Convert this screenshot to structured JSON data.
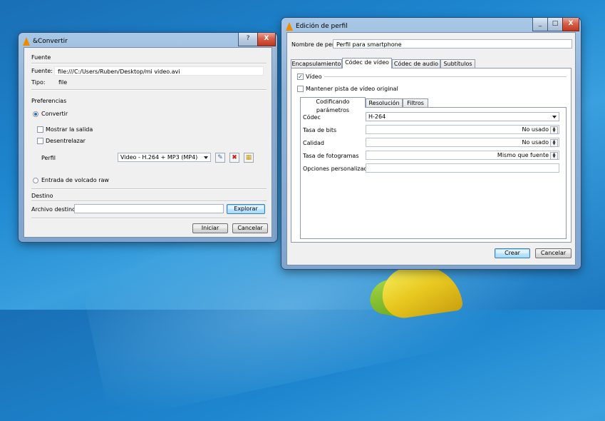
{
  "convert_window": {
    "title": "&Convertir",
    "help_label": "?",
    "close_label": "X",
    "source": {
      "section": "Fuente",
      "source_label": "Fuente:",
      "source_value": "file:///C:/Users/Ruben/Desktop/mi video.avi",
      "type_label": "Tipo:",
      "type_value": "file"
    },
    "preferences": {
      "section": "Preferencias",
      "convert_label": "Convertir",
      "show_output_label": "Mostrar la salida",
      "deinterlace_label": "Desentrelazar",
      "profile_label": "Perfil",
      "profile_value": "Video - H.264 + MP3 (MP4)",
      "raw_dump_label": "Entrada de volcado raw"
    },
    "destination": {
      "section": "Destino",
      "file_label": "Archivo destino:",
      "file_value": "",
      "browse_label": "Explorar"
    },
    "start_label": "Iniciar",
    "cancel_label": "Cancelar"
  },
  "profile_window": {
    "title": "Edición de perfil",
    "minimize_label": "_",
    "maximize_label": "□",
    "close_label": "X",
    "profile_name_label": "Nombre de perfil",
    "profile_name_value": "Perfil para smartphone",
    "tabs": [
      "Encapsulamiento",
      "Códec de vídeo",
      "Códec de audio",
      "Subtítulos"
    ],
    "active_tab": "Códec de vídeo",
    "video_label": "Vídeo",
    "keep_track_label": "Mantener pista de vídeo original",
    "inner_tabs": [
      "Codificando parámetros",
      "Resolución",
      "Filtros"
    ],
    "codec_label": "Códec",
    "codec_value": "H-264",
    "bitrate_label": "Tasa de bits",
    "bitrate_value": "No usado",
    "quality_label": "Calidad",
    "quality_value": "No usado",
    "framerate_label": "Tasa de fotogramas",
    "framerate_value": "Mismo que fuente",
    "custom_options_label": "Opciones personalizadas",
    "custom_options_value": "",
    "create_label": "Crear",
    "cancel_label": "Cancelar"
  }
}
